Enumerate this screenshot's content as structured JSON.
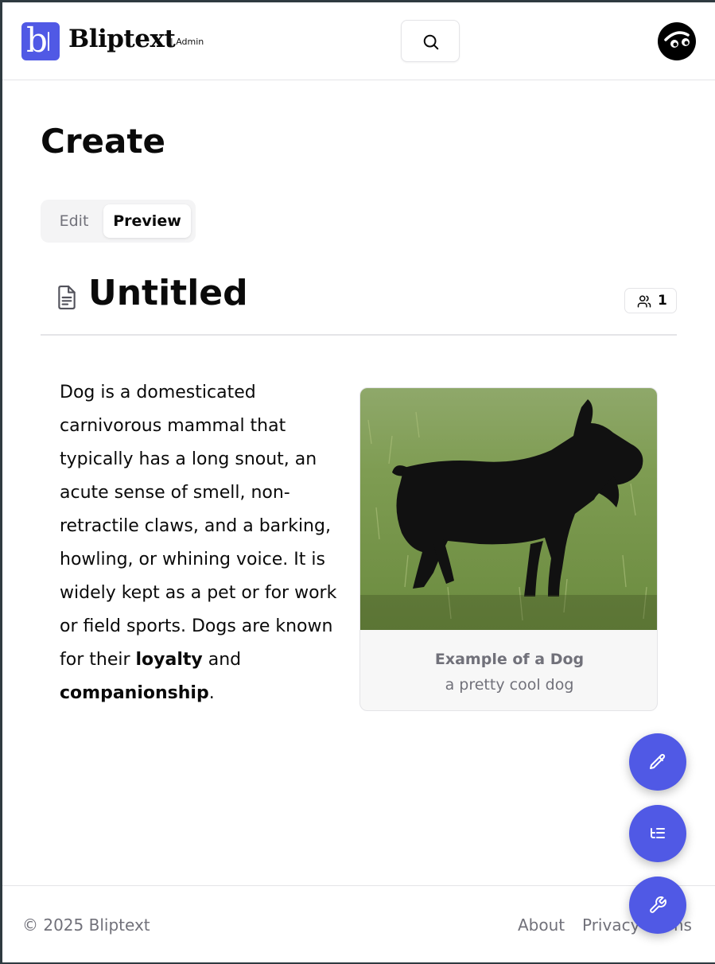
{
  "header": {
    "brand": "Bliptext",
    "brand_suffix": "| Admin",
    "search_icon": "search-icon",
    "avatar_icon": "user-avatar"
  },
  "page": {
    "title": "Create"
  },
  "tabs": [
    {
      "label": "Edit",
      "active": false
    },
    {
      "label": "Preview",
      "active": true
    }
  ],
  "document": {
    "title": "Untitled",
    "collaborators_count": "1",
    "body": {
      "intro": "Dog is a domesticated carnivorous mammal that typically has a long snout, an acute sense of smell, non-retractile claws, and a barking, howling, or whining voice. It is widely kept as a pet or for work or field sports. Dogs are known for their ",
      "bold1": "loyalty",
      "mid": " and ",
      "bold2": "companionship",
      "end": "."
    },
    "figure": {
      "caption_title": "Example of a Dog",
      "caption_subtitle": "a pretty cool dog"
    }
  },
  "footer": {
    "copyright": "© 2025 Bliptext",
    "links": [
      "About",
      "Privacy",
      "Terms"
    ]
  },
  "fab": {
    "edit_icon": "pencil-icon",
    "outline_icon": "list-tree-icon",
    "tools_icon": "wrench-icon"
  },
  "colors": {
    "accent": "#5059e5",
    "muted_text": "#71717a",
    "border": "#e4e4e7"
  }
}
